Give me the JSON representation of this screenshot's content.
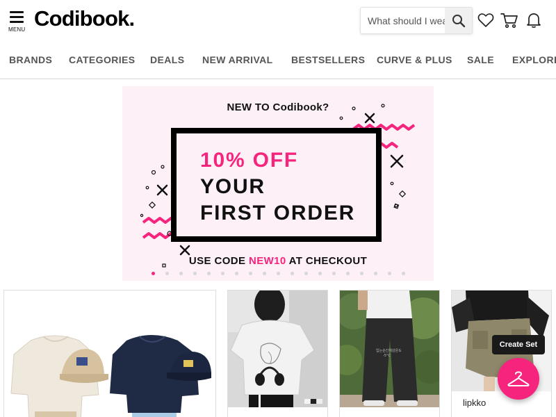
{
  "header": {
    "menu_label": "MENU",
    "logo": "Codibook.",
    "search_placeholder": "What should I wear?"
  },
  "nav": {
    "items": [
      "BRANDS",
      "CATEGORIES",
      "DEALS",
      "NEW ARRIVAL",
      "BESTSELLERS",
      "CURVE & PLUS",
      "SALE",
      "EXPLORE"
    ]
  },
  "banner": {
    "top_text": "NEW TO Codibook?",
    "offer": "10% OFF",
    "line2": "YOUR",
    "line3": "FIRST ORDER",
    "code_prefix": "USE CODE ",
    "code": "NEW10",
    "code_suffix": " AT CHECKOUT",
    "slide_count": 19,
    "active_slide": 1
  },
  "products": {
    "card4_brand": "lipkko"
  },
  "actions": {
    "create_set_label": "Create Set"
  },
  "colors": {
    "accent": "#f7247e",
    "banner_bg": "#fdf0f7",
    "text": "#111111",
    "nav_text": "#555555"
  },
  "icons": [
    "menu-icon",
    "search-icon",
    "heart-icon",
    "cart-icon",
    "bell-icon",
    "hanger-icon"
  ]
}
